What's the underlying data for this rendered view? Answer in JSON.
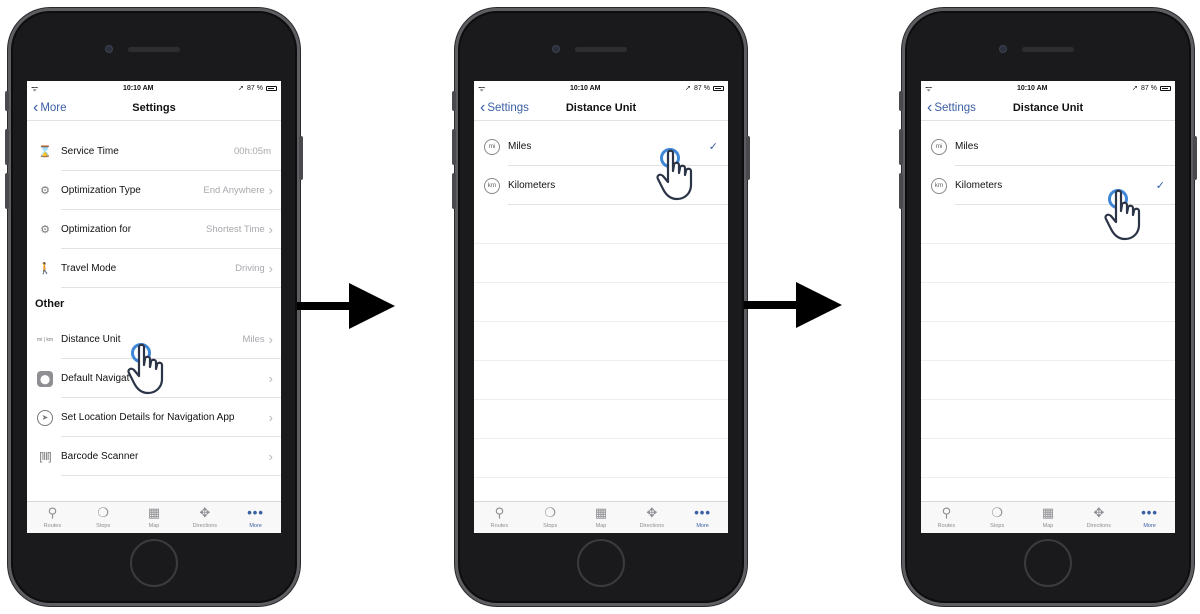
{
  "status": {
    "time": "10:10 AM",
    "battery": "87 %"
  },
  "colors": {
    "accent": "#3a5fa3",
    "tap": "#3e86d6",
    "phone_body": "#1a1a1c"
  },
  "screen1": {
    "back": "More",
    "title": "Settings",
    "rows": [
      {
        "label": "Service Time",
        "value": "00h:05m",
        "icon": "hourglass-icon"
      },
      {
        "label": "Optimization Type",
        "value": "End Anywhere",
        "icon": "optimization-type-icon"
      },
      {
        "label": "Optimization for",
        "value": "Shortest Time",
        "icon": "optimization-for-icon"
      },
      {
        "label": "Travel Mode",
        "value": "Driving",
        "icon": "travel-mode-icon"
      }
    ],
    "section_other": "Other",
    "other_rows": [
      {
        "label": "Distance Unit",
        "value": "Miles",
        "icon": "distance-unit-icon",
        "icon_text": "mi | km"
      },
      {
        "label": "Default Navigat",
        "value": "",
        "icon": "map-pin-icon"
      },
      {
        "label": "Set Location Details for Navigation App",
        "value": "",
        "icon": "navigation-arrow-icon"
      },
      {
        "label": "Barcode Scanner",
        "value": "",
        "icon": "barcode-icon"
      }
    ]
  },
  "screen2": {
    "back": "Settings",
    "title": "Distance Unit",
    "rows": [
      {
        "label": "Miles",
        "icon_text": "mi",
        "checked": true
      },
      {
        "label": "Kilometers",
        "icon_text": "km",
        "checked": false
      }
    ]
  },
  "screen3": {
    "back": "Settings",
    "title": "Distance Unit",
    "rows": [
      {
        "label": "Miles",
        "icon_text": "mi",
        "checked": false
      },
      {
        "label": "Kilometers",
        "icon_text": "km",
        "checked": true
      }
    ]
  },
  "tabs": [
    {
      "label": "Routes",
      "icon": "routes-icon",
      "glyph": "⚲"
    },
    {
      "label": "Stops",
      "icon": "stops-icon",
      "glyph": "❍"
    },
    {
      "label": "Map",
      "icon": "map-icon",
      "glyph": "▦"
    },
    {
      "label": "Directions",
      "icon": "directions-icon",
      "glyph": "✥"
    },
    {
      "label": "More",
      "icon": "more-dots-icon",
      "glyph": "•••"
    }
  ],
  "checkmark": "✓"
}
